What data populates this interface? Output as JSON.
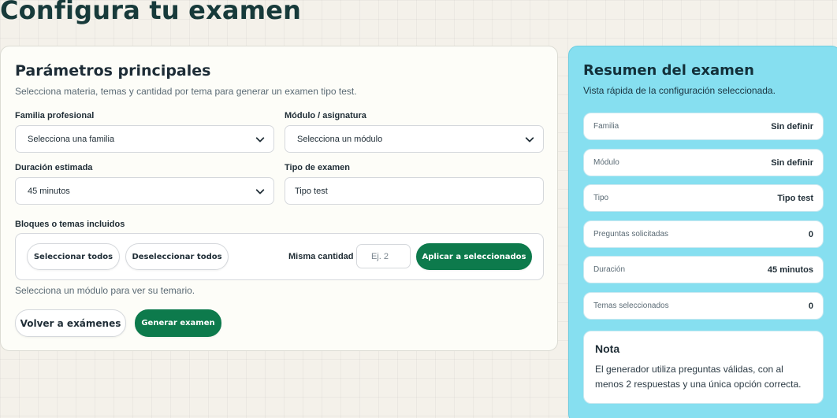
{
  "page": {
    "title": "Configura tu examen"
  },
  "main": {
    "title": "Parámetros principales",
    "subtitle": "Selecciona materia, temas y cantidad por tema para generar un examen tipo test.",
    "fields": {
      "familia": {
        "label": "Familia profesional",
        "value": "Selecciona una familia"
      },
      "modulo": {
        "label": "Módulo / asignatura",
        "value": "Selecciona un módulo"
      },
      "duracion": {
        "label": "Duración estimada",
        "value": "45 minutos"
      },
      "tipo": {
        "label": "Tipo de examen",
        "value": "Tipo test"
      }
    },
    "blocks": {
      "label": "Bloques o temas incluidos",
      "select_all": "Seleccionar todos",
      "deselect_all": "Deseleccionar todos",
      "same_qty_label": "Misma cantidad",
      "same_qty_placeholder": "Ej. 2",
      "apply": "Aplicar a seleccionados",
      "hint": "Selecciona un módulo para ver su temario."
    },
    "actions": {
      "back": "Volver a exámenes",
      "generate": "Generar examen"
    }
  },
  "summary": {
    "title": "Resumen del examen",
    "subtitle": "Vista rápida de la configuración seleccionada.",
    "rows": [
      {
        "key": "Familia",
        "value": "Sin definir"
      },
      {
        "key": "Módulo",
        "value": "Sin definir"
      },
      {
        "key": "Tipo",
        "value": "Tipo test"
      },
      {
        "key": "Preguntas solicitadas",
        "value": "0"
      },
      {
        "key": "Duración",
        "value": "45 minutos"
      },
      {
        "key": "Temas seleccionados",
        "value": "0"
      }
    ],
    "note": {
      "title": "Nota",
      "text": "El generador utiliza preguntas válidas, con al menos 2 respuestas y una única opción correcta."
    }
  },
  "colors": {
    "accent": "#0d7a4c",
    "summary_bg": "#86dff0",
    "title": "#173a3a"
  },
  "icons": {
    "select_arrow": "chevron-down-icon"
  }
}
